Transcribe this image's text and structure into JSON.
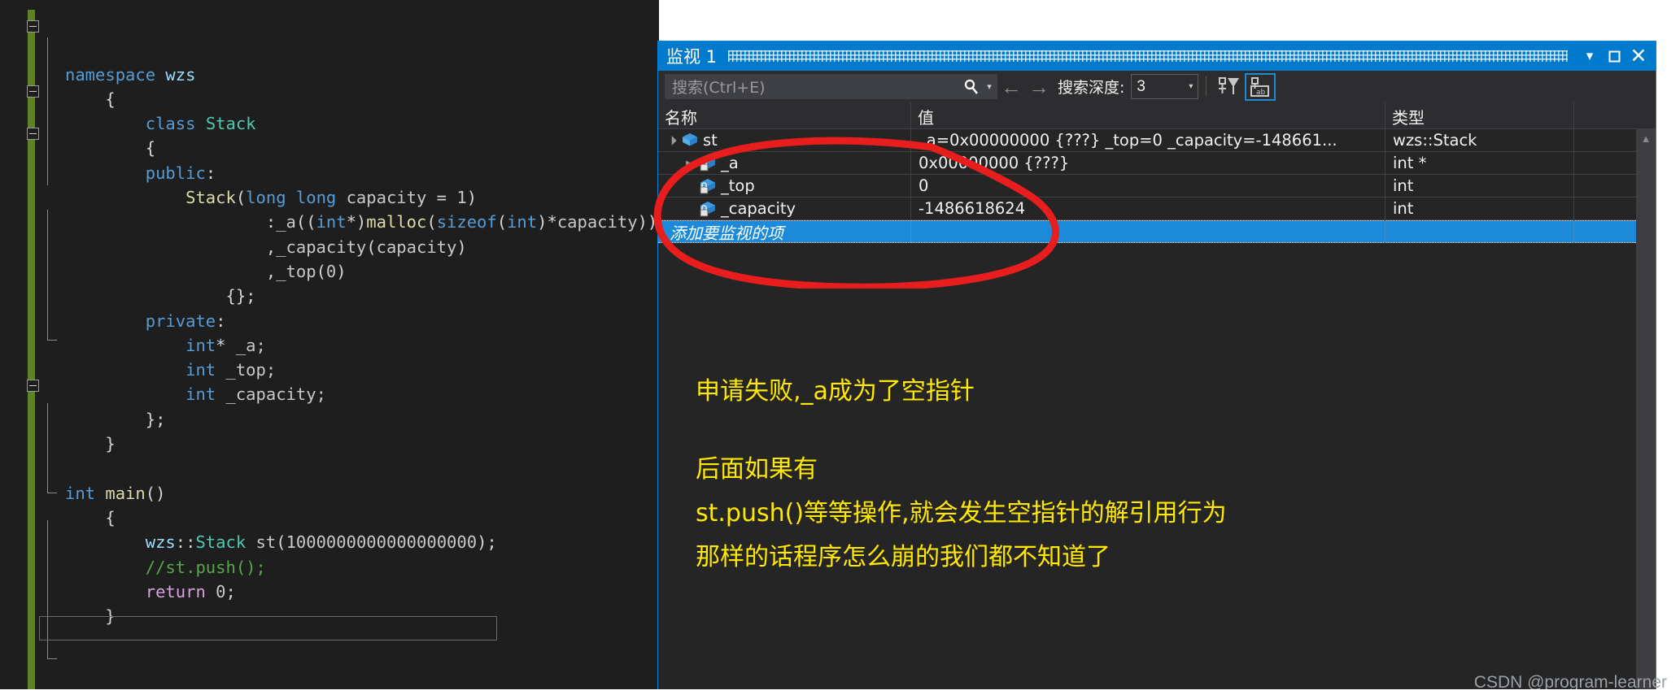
{
  "editor": {
    "lines": [
      [
        {
          "t": "namespace ",
          "c": "kw"
        },
        {
          "t": "wzs",
          "c": "ns"
        }
      ],
      [
        {
          "t": "{",
          "c": "punct"
        }
      ],
      [
        {
          "t": "class ",
          "c": "kw"
        },
        {
          "t": "Stack",
          "c": "type"
        }
      ],
      [
        {
          "t": "{",
          "c": "punct"
        }
      ],
      [
        {
          "t": "public",
          "c": "kw"
        },
        {
          "t": ":",
          "c": "punct"
        }
      ],
      [
        {
          "t": "Stack",
          "c": "fn"
        },
        {
          "t": "(",
          "c": "punct"
        },
        {
          "t": "long long ",
          "c": "kw"
        },
        {
          "t": "capacity",
          "c": "plain"
        },
        {
          "t": " = ",
          "c": "punct"
        },
        {
          "t": "1",
          "c": "plain"
        },
        {
          "t": ")",
          "c": "punct"
        }
      ],
      [
        {
          "t": ":",
          "c": "punct"
        },
        {
          "t": "_a",
          "c": "plain"
        },
        {
          "t": "((",
          "c": "punct"
        },
        {
          "t": "int",
          "c": "kw"
        },
        {
          "t": "*)",
          "c": "punct"
        },
        {
          "t": "malloc",
          "c": "fn"
        },
        {
          "t": "(",
          "c": "punct"
        },
        {
          "t": "sizeof",
          "c": "kw"
        },
        {
          "t": "(",
          "c": "punct"
        },
        {
          "t": "int",
          "c": "kw"
        },
        {
          "t": ")*",
          "c": "punct"
        },
        {
          "t": "capacity",
          "c": "plain"
        },
        {
          "t": "))",
          "c": "punct"
        }
      ],
      [
        {
          "t": ",",
          "c": "punct"
        },
        {
          "t": "_capacity",
          "c": "plain"
        },
        {
          "t": "(",
          "c": "punct"
        },
        {
          "t": "capacity",
          "c": "plain"
        },
        {
          "t": ")",
          "c": "punct"
        }
      ],
      [
        {
          "t": ",",
          "c": "punct"
        },
        {
          "t": "_top",
          "c": "plain"
        },
        {
          "t": "(",
          "c": "punct"
        },
        {
          "t": "0",
          "c": "plain"
        },
        {
          "t": ")",
          "c": "punct"
        }
      ],
      [
        {
          "t": "{};",
          "c": "punct"
        }
      ],
      [
        {
          "t": "private",
          "c": "kw"
        },
        {
          "t": ":",
          "c": "punct"
        }
      ],
      [
        {
          "t": "int",
          "c": "kw"
        },
        {
          "t": "* ",
          "c": "punct"
        },
        {
          "t": "_a;",
          "c": "plain"
        }
      ],
      [
        {
          "t": "int ",
          "c": "kw"
        },
        {
          "t": "_top;",
          "c": "plain"
        }
      ],
      [
        {
          "t": "int ",
          "c": "kw"
        },
        {
          "t": "_capacity;",
          "c": "plain"
        }
      ],
      [
        {
          "t": "};",
          "c": "punct"
        }
      ],
      [
        {
          "t": "}",
          "c": "punct"
        }
      ],
      [],
      [
        {
          "t": "int ",
          "c": "kw"
        },
        {
          "t": "main",
          "c": "fn"
        },
        {
          "t": "()",
          "c": "punct"
        }
      ],
      [
        {
          "t": "{",
          "c": "punct"
        }
      ],
      [
        {
          "t": "wzs",
          "c": "ns"
        },
        {
          "t": "::",
          "c": "punct"
        },
        {
          "t": "Stack ",
          "c": "type"
        },
        {
          "t": "st",
          "c": "plain"
        },
        {
          "t": "(",
          "c": "punct"
        },
        {
          "t": "1000000000000000000",
          "c": "plain"
        },
        {
          "t": ");",
          "c": "punct"
        }
      ],
      [
        {
          "t": "//st.push();",
          "c": "cmt"
        }
      ],
      [
        {
          "t": "return ",
          "c": "ctrl"
        },
        {
          "t": "0",
          "c": "plain"
        },
        {
          "t": ";",
          "c": "punct"
        }
      ],
      [
        {
          "t": "}",
          "c": "punct"
        }
      ]
    ],
    "indents": [
      0,
      1,
      2,
      2,
      2,
      3,
      5,
      5,
      5,
      4,
      2,
      3,
      3,
      3,
      2,
      1,
      0,
      0,
      1,
      2,
      2,
      2,
      1
    ]
  },
  "watch": {
    "title": "监视 1",
    "title_buttons": {
      "dropdown": "▾",
      "maximize": "▫",
      "close": "✕"
    },
    "toolbar": {
      "search_placeholder": "搜索(Ctrl+E)",
      "search_icon": "search-icon",
      "search_caret": "▾",
      "back_arrow": "←",
      "forward_arrow": "→",
      "depth_label": "搜索深度:",
      "depth_value": "3",
      "depth_caret": "▾"
    },
    "columns": [
      "名称",
      "值",
      "类型"
    ],
    "rows": [
      {
        "expander": "open",
        "indent": 0,
        "icon": "cube-icon",
        "name": "st",
        "value": "_a=0x00000000 {???} _top=0 _capacity=-148661...",
        "type": "wzs::Stack"
      },
      {
        "expander": "closed",
        "indent": 1,
        "icon": "cube-lock-icon",
        "name": "_a",
        "value": "0x00000000 {???}",
        "type": "int *"
      },
      {
        "expander": "none",
        "indent": 1,
        "icon": "cube-lock-icon",
        "name": "_top",
        "value": "0",
        "type": "int"
      },
      {
        "expander": "none",
        "indent": 1,
        "icon": "cube-lock-icon",
        "name": "_capacity",
        "value": "-1486618624",
        "type": "int"
      }
    ],
    "add_row_placeholder": "添加要监视的项"
  },
  "annotations": [
    "申请失败,_a成为了空指针",
    "后面如果有",
    "st.push()等等操作,就会发生空指针的解引用行为",
    "那样的话程序怎么崩的我们都不知道了"
  ],
  "watermark": "CSDN @program-learner",
  "colors": {
    "accent_blue": "#007acc",
    "selection_blue": "#1c8ad8",
    "annotation_yellow": "#ffe900",
    "circle_red": "#e81e1e",
    "editor_bg": "#1e1e1e",
    "change_bar_green": "#5f8127"
  }
}
